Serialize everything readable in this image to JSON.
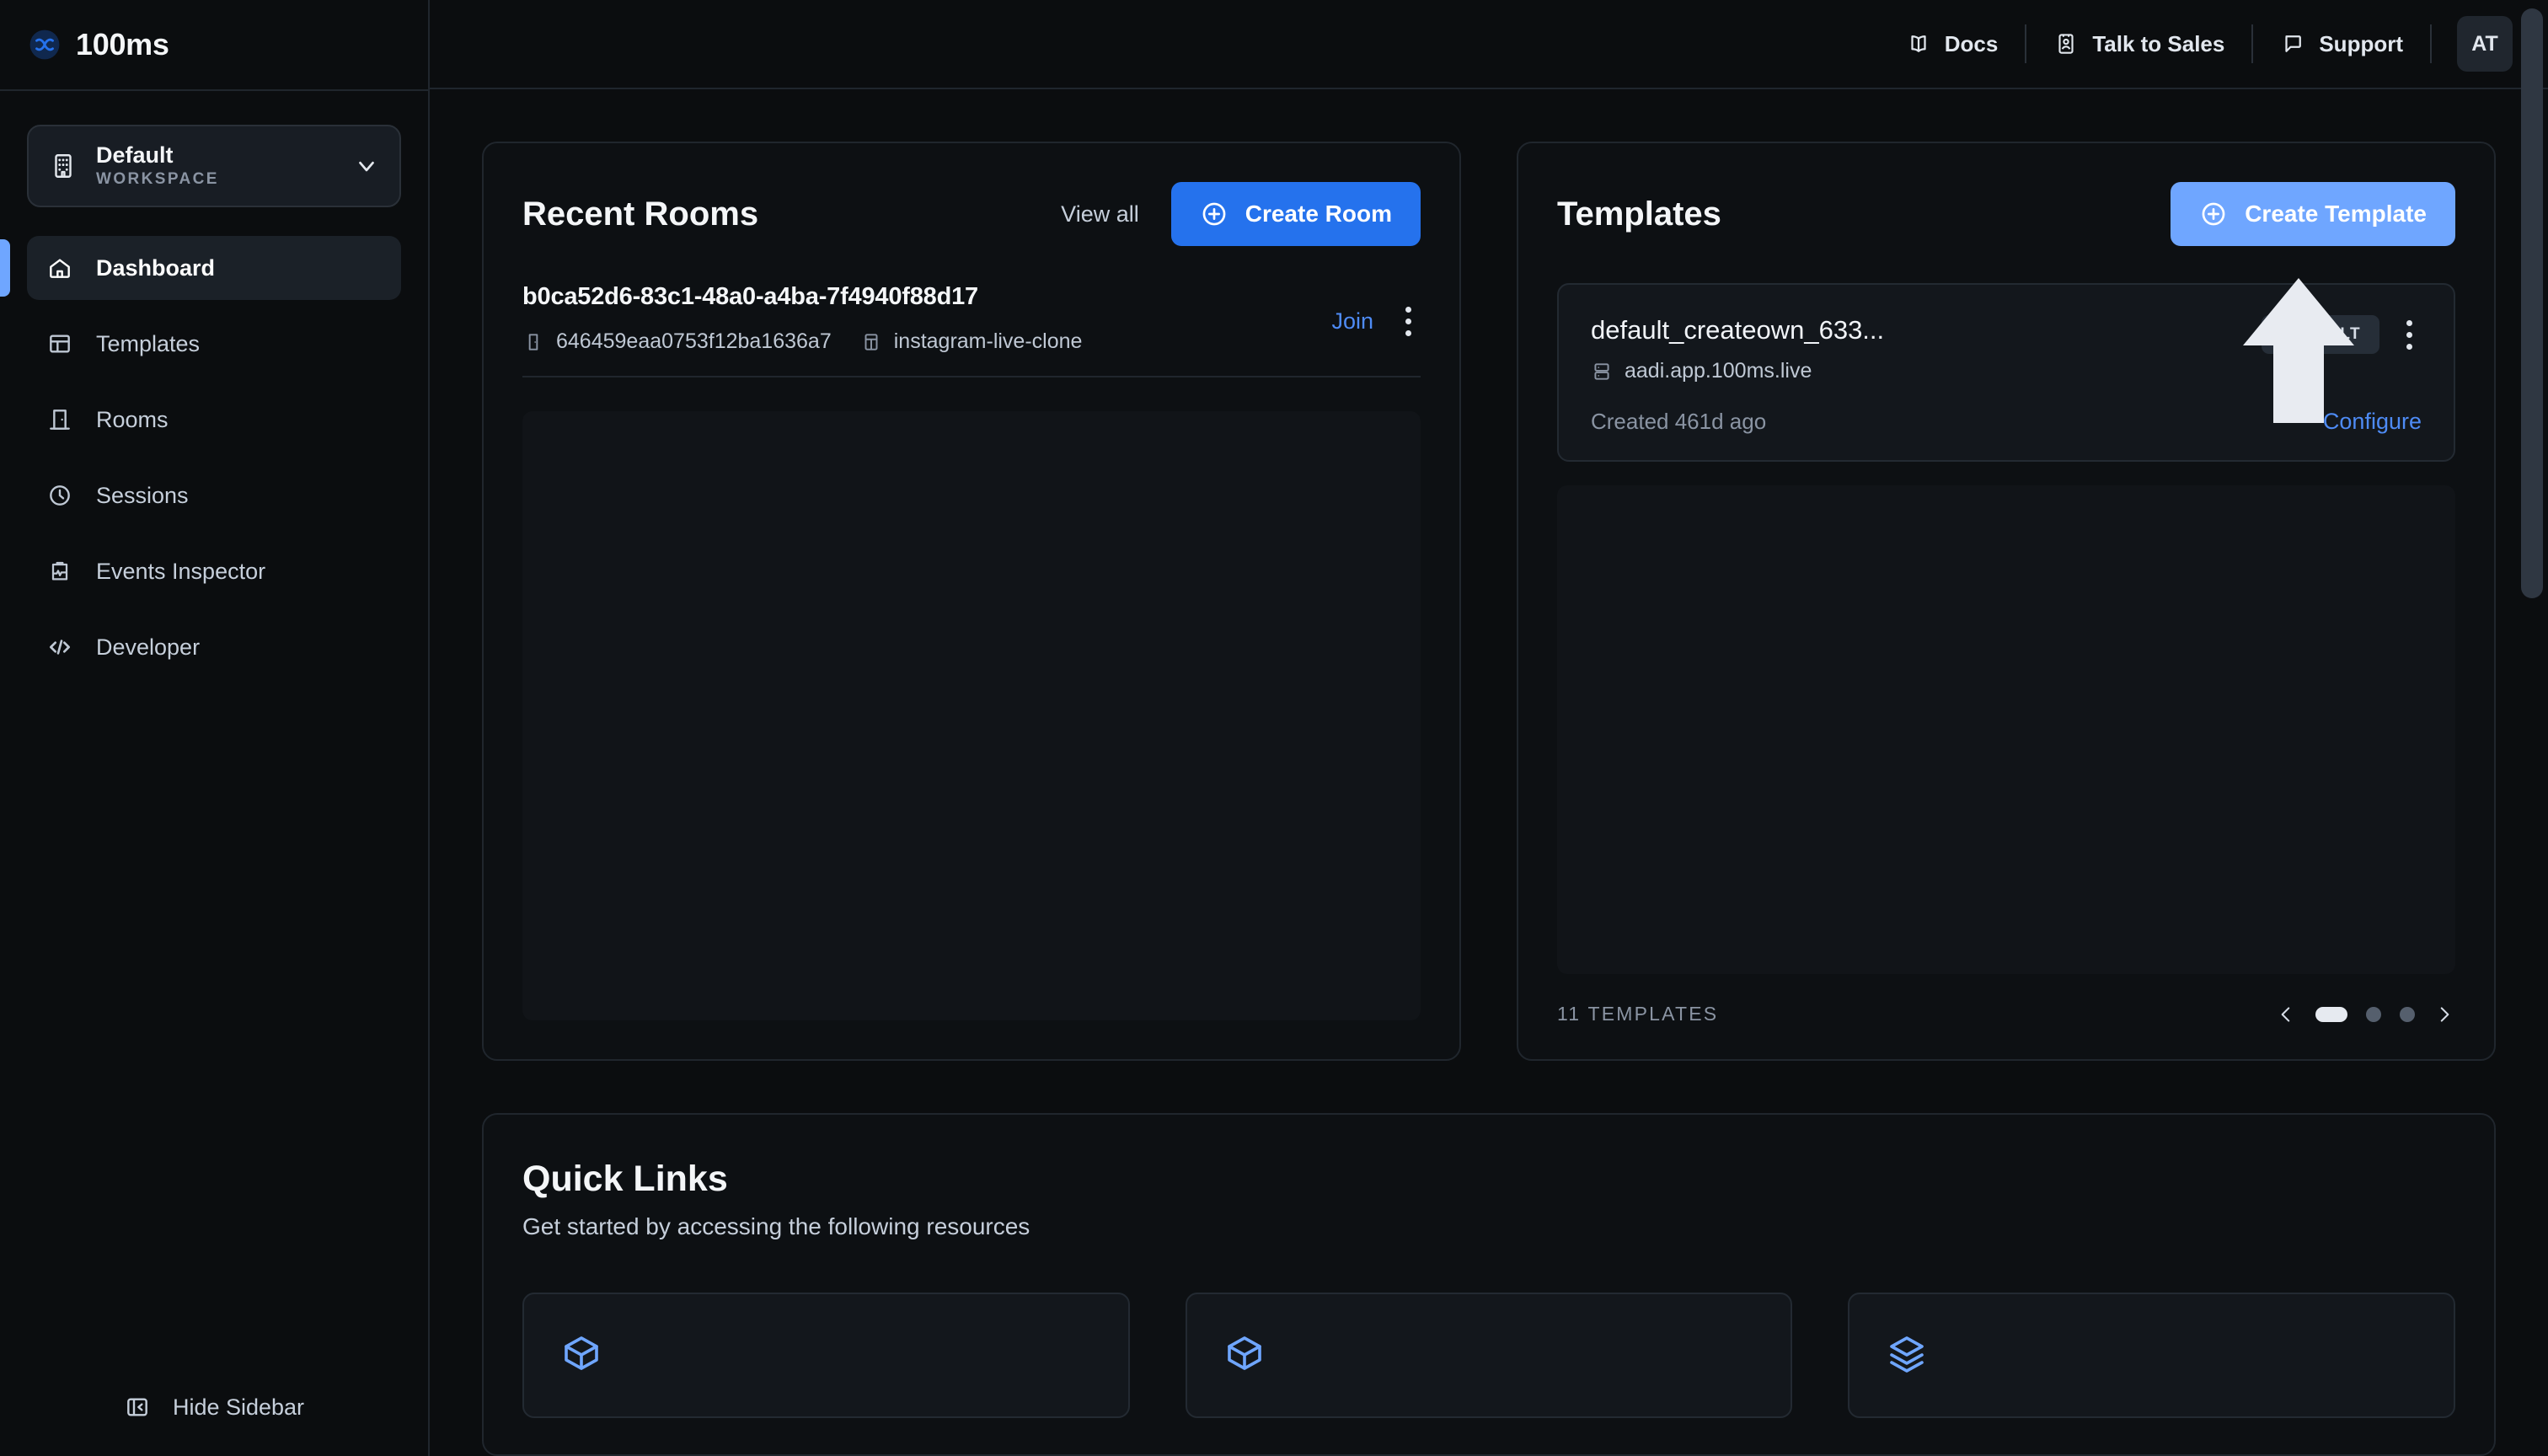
{
  "brand": {
    "name": "100ms",
    "logo_icon": "infinity-logo-icon",
    "accent": "#2572ED"
  },
  "workspace": {
    "name": "Default",
    "label": "WORKSPACE",
    "icon": "building-icon",
    "chevron_icon": "chevron-down-icon"
  },
  "sidebar": {
    "items": [
      {
        "label": "Dashboard",
        "icon": "home-icon",
        "active": true
      },
      {
        "label": "Templates",
        "icon": "layout-icon",
        "active": false
      },
      {
        "label": "Rooms",
        "icon": "door-icon",
        "active": false
      },
      {
        "label": "Sessions",
        "icon": "clock-icon",
        "active": false
      },
      {
        "label": "Events Inspector",
        "icon": "clipboard-pulse-icon",
        "active": false
      },
      {
        "label": "Developer",
        "icon": "code-icon",
        "active": false
      }
    ],
    "hide_sidebar": {
      "label": "Hide Sidebar",
      "icon": "panel-collapse-icon"
    }
  },
  "topbar": {
    "links": [
      {
        "label": "Docs",
        "icon": "book-icon"
      },
      {
        "label": "Talk to Sales",
        "icon": "id-card-icon"
      },
      {
        "label": "Support",
        "icon": "chat-bubble-icon"
      }
    ],
    "avatar": {
      "initials": "AT"
    }
  },
  "recent_rooms": {
    "title": "Recent Rooms",
    "view_all": "View all",
    "create_button": {
      "label": "Create Room",
      "icon": "plus-circle-icon"
    },
    "rooms": [
      {
        "id": "b0ca52d6-83c1-48a0-a4ba-7f4940f88d17",
        "room_code": "646459eaa0753f12ba1636a7",
        "room_code_icon": "door-icon",
        "template": "instagram-live-clone",
        "template_icon": "layout-icon",
        "join_label": "Join",
        "menu_icon": "kebab-menu-icon"
      }
    ]
  },
  "templates": {
    "title": "Templates",
    "create_button": {
      "label": "Create Template",
      "icon": "plus-circle-icon"
    },
    "items": [
      {
        "name": "default_createown_633...",
        "subdomain": "aadi.app.100ms.live",
        "subdomain_icon": "server-icon",
        "badge": "DEFAULT",
        "created": "Created 461d ago",
        "configure_label": "Configure",
        "menu_icon": "kebab-menu-icon"
      }
    ],
    "count_label": "11 TEMPLATES",
    "pager": {
      "prev_icon": "chevron-left-icon",
      "next_icon": "chevron-right-icon",
      "pages": 3,
      "current": 1
    }
  },
  "quick_links": {
    "title": "Quick Links",
    "subtitle": "Get started by accessing the following resources",
    "cards": [
      {
        "icon": "box-icon"
      },
      {
        "icon": "box-icon"
      },
      {
        "icon": "layers-icon"
      }
    ]
  },
  "cursor": {
    "icon": "arrow-up-cursor"
  }
}
